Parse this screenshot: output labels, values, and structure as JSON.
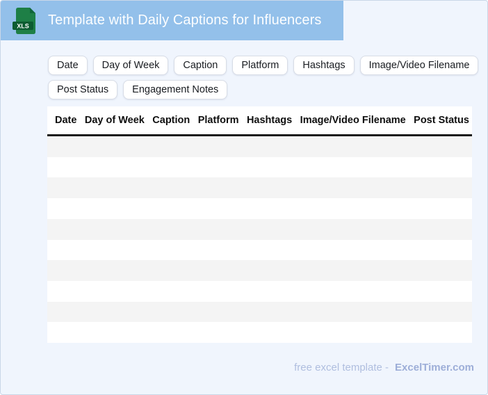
{
  "header": {
    "title": "Template with Daily Captions for Influencers",
    "file_badge": "XLS"
  },
  "field_chips": [
    "Date",
    "Day of Week",
    "Caption",
    "Platform",
    "Hashtags",
    "Image/Video Filename",
    "Post Status",
    "Engagement Notes"
  ],
  "table": {
    "columns": [
      "Date",
      "Day of Week",
      "Caption",
      "Platform",
      "Hashtags",
      "Image/Video Filename",
      "Post Status"
    ],
    "empty_row_count": 10
  },
  "footer": {
    "caption": "free excel template -",
    "brand": "ExcelTimer.com"
  },
  "colors": {
    "banner_blue": "#93C0EA",
    "page_background": "#F0F5FD",
    "icon_green": "#1E7F46",
    "icon_band_green": "#0D5C32",
    "row_stripe": "#F4F4F4",
    "header_underline": "#191919",
    "footer_text": "#AFBEDF",
    "footer_brand": "#9DAED8"
  }
}
